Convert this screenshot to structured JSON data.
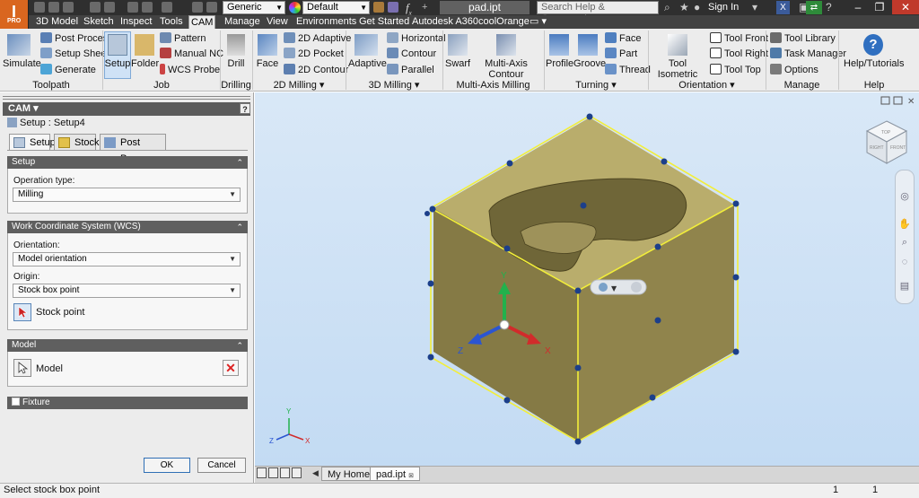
{
  "app": {
    "logo_letter": "I",
    "logo_sub": "PRO",
    "doc_title": "pad.ipt"
  },
  "quick_access": {
    "material": "Generic",
    "appearance": "Default",
    "fx": "f",
    "fx_sub": "x"
  },
  "search": {
    "placeholder": "Search Help & Commands..."
  },
  "account": {
    "sign_in": "Sign In"
  },
  "tabs": [
    "3D Model",
    "Sketch",
    "Inspect",
    "Tools",
    "CAM",
    "Manage",
    "View",
    "Environments",
    "Get Started",
    "Autodesk A360",
    "coolOrange"
  ],
  "ribbon": {
    "toolpath": {
      "simulate": "Simulate",
      "post_process": "Post Process",
      "setup_sheet": "Setup Sheet",
      "generate": "Generate",
      "label": "Toolpath"
    },
    "job": {
      "setup": "Setup",
      "folder": "Folder",
      "pattern": "Pattern",
      "manual_nc": "Manual NC",
      "wcs_probe": "WCS Probe",
      "label": "Job"
    },
    "drilling": {
      "drill": "Drill",
      "label": "Drilling"
    },
    "milling2d": {
      "face": "Face",
      "adaptive": "2D Adaptive",
      "pocket": "2D Pocket",
      "contour": "2D Contour",
      "label": "2D Milling ▾"
    },
    "milling3d": {
      "adaptive": "Adaptive",
      "horizontal": "Horizontal",
      "contour": "Contour",
      "parallel": "Parallel",
      "label": "3D Milling ▾"
    },
    "multiaxis": {
      "swarf": "Swarf",
      "contour": "Multi-Axis Contour",
      "label": "Multi-Axis Milling"
    },
    "turning": {
      "profile": "Profile",
      "groove": "Groove",
      "face": "Face",
      "part": "Part",
      "thread": "Thread",
      "label": "Turning ▾"
    },
    "orientation": {
      "iso": "Tool Isometric",
      "front": "Tool Front",
      "right": "Tool Right",
      "top": "Tool Top",
      "label": "Orientation ▾"
    },
    "manage": {
      "library": "Tool Library",
      "task": "Task Manager",
      "options": "Options",
      "label": "Manage"
    },
    "help": {
      "tutorials": "Help/Tutorials",
      "label": "Help"
    }
  },
  "panel": {
    "title": "CAM ▾",
    "help": "?",
    "setup_name": "Setup : Setup4",
    "tabs": [
      "Setup",
      "Stock",
      "Post Process"
    ],
    "setup_section": {
      "title": "Setup",
      "op_type_label": "Operation type:",
      "op_type_value": "Milling"
    },
    "wcs_section": {
      "title": "Work Coordinate System (WCS)",
      "orientation_label": "Orientation:",
      "orientation_value": "Model orientation",
      "origin_label": "Origin:",
      "origin_value": "Stock box point",
      "pick_label": "Stock point"
    },
    "model_section": {
      "title": "Model",
      "pick_label": "Model"
    },
    "fixture_section": {
      "title": "Fixture"
    },
    "ok": "OK",
    "cancel": "Cancel"
  },
  "viewport": {
    "axis_x": "X",
    "axis_y": "Y",
    "axis_z": "Z",
    "viewcube_top": "TOP",
    "viewcube_right": "RIGHT",
    "viewcube_front": "FRONT"
  },
  "doc_tabs": [
    "My Home",
    "pad.ipt"
  ],
  "status": {
    "text": "Select stock box point",
    "num1": "1",
    "num2": "1"
  },
  "colors": {
    "ribbon_bg": "#ececec",
    "titlebar": "#2f2f2f",
    "accent_orange": "#d9661f",
    "viewport_top": "#d9e8f7",
    "viewport_bottom": "#c3dbf3",
    "part_fill": "#a89c5a",
    "stock_edge": "#f2ee3a"
  }
}
